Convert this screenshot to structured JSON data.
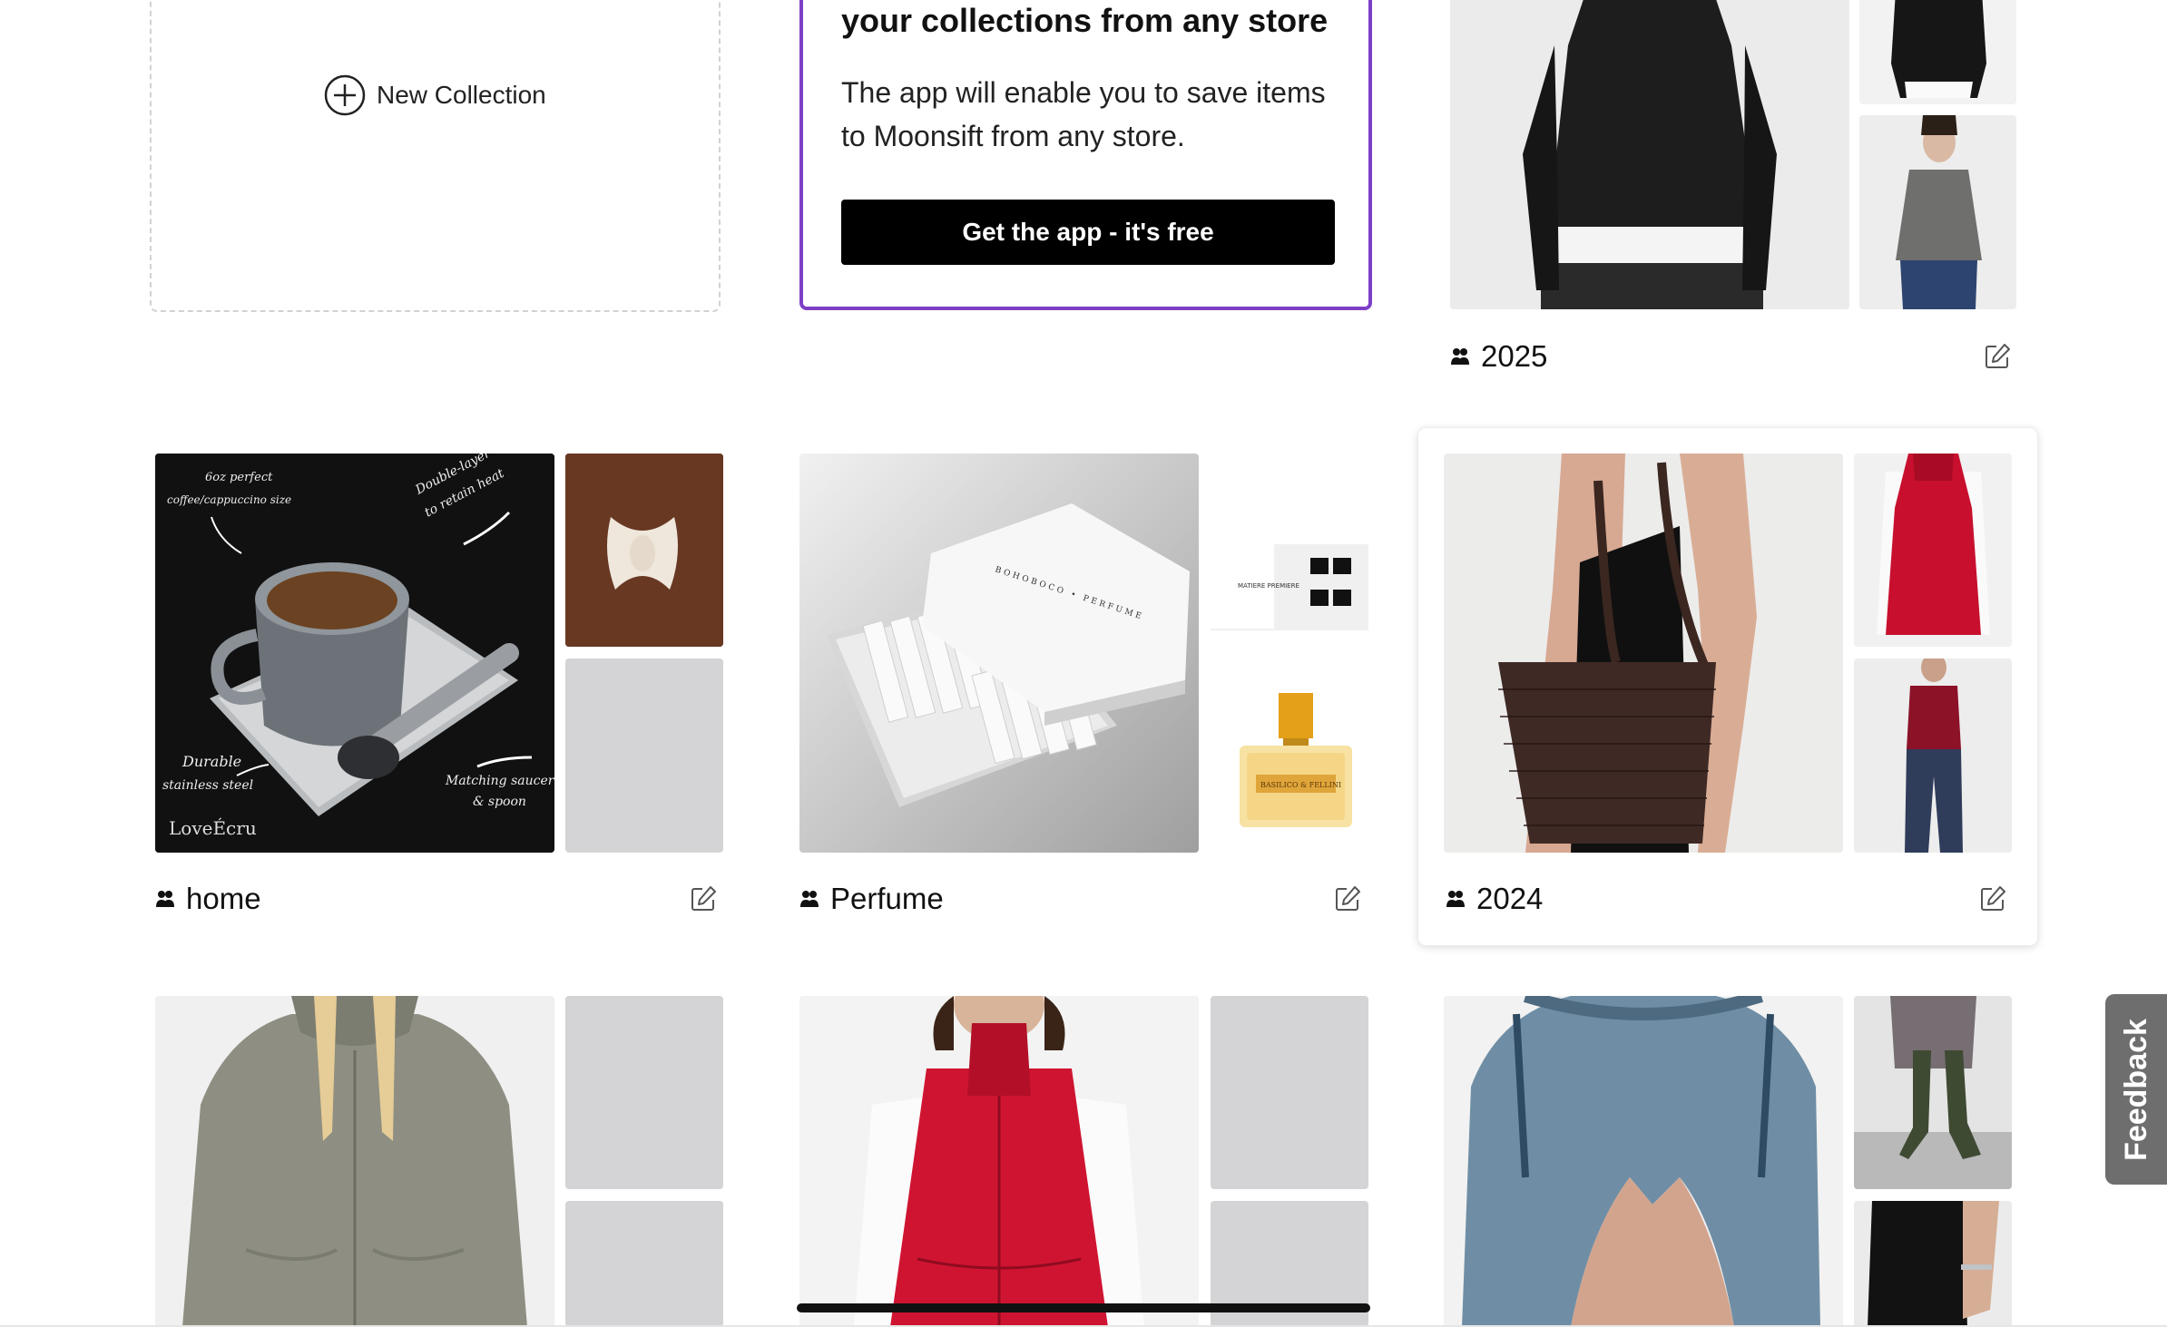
{
  "new_collection": {
    "label": "New Collection",
    "icon": "plus-circle-icon"
  },
  "promo": {
    "title": "your collections from any store",
    "body": "The app will enable you to save items to Moonsift from any store.",
    "button": "Get the app - it's free",
    "accent": "#7e3fc7"
  },
  "collections": [
    {
      "name": "2025",
      "icon": "people-icon"
    },
    {
      "name": "home",
      "icon": "people-icon"
    },
    {
      "name": "Perfume",
      "icon": "people-icon"
    },
    {
      "name": "2024",
      "icon": "people-icon"
    }
  ],
  "images": {
    "coffee_annotations": [
      "6oz perfect",
      "coffee/cappuccino size",
      "Double-layer design",
      "to retain heat",
      "Durable",
      "stainless steel",
      "Matching saucer",
      "& spoon",
      "LoveÉcru"
    ],
    "perfume_box": "BOHOBOCO • PERFUME",
    "perfume_card": "MATIERE PREMIERE",
    "perfume_bottle_label": "BASILICO & FELLINI"
  },
  "feedback_tab": "Feedback"
}
